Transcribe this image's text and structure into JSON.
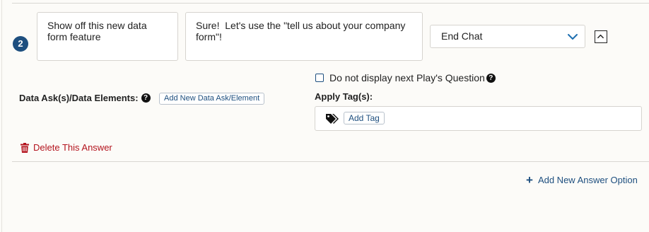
{
  "answer_row": {
    "number": "2",
    "question_text": "Show off this new data form feature",
    "answer_text": "Sure!  Let's use the \"tell us about your company form\"!",
    "action_select": {
      "selected": "End Chat"
    }
  },
  "options": {
    "hide_next_question_label": "Do not display next Play's Question",
    "hide_next_question_checked": false
  },
  "tags": {
    "label": "Apply Tag(s):",
    "add_button": "Add Tag"
  },
  "data_ask": {
    "label": "Data Ask(s)/Data Elements:",
    "add_button": "Add New Data Ask/Element"
  },
  "delete_label": "Delete This Answer",
  "add_answer_label": "Add New Answer Option",
  "colors": {
    "accent": "#1e4f7f",
    "danger": "#b3131d",
    "background": "#fcfbf8"
  }
}
